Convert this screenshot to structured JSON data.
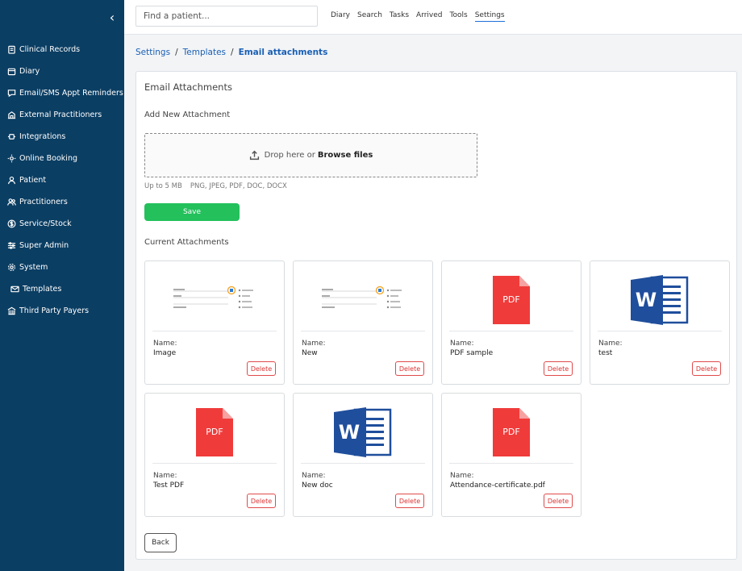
{
  "sidebar": {
    "items": [
      {
        "label": "Clinical Records",
        "icon": "clipboard-icon"
      },
      {
        "label": "Diary",
        "icon": "calendar-icon"
      },
      {
        "label": "Email/SMS Appt Reminders",
        "icon": "chat-icon"
      },
      {
        "label": "External Practitioners",
        "icon": "building-icon"
      },
      {
        "label": "Integrations",
        "icon": "plug-icon"
      },
      {
        "label": "Online Booking",
        "icon": "sun-icon"
      },
      {
        "label": "Patient",
        "icon": "user-icon"
      },
      {
        "label": "Practitioners",
        "icon": "users-icon"
      },
      {
        "label": "Service/Stock",
        "icon": "dollar-icon"
      },
      {
        "label": "Super Admin",
        "icon": "sliders-icon"
      },
      {
        "label": "System",
        "icon": "gear-icon"
      },
      {
        "label": "Templates",
        "icon": "envelope-icon"
      },
      {
        "label": "Third Party Payers",
        "icon": "bank-icon"
      }
    ]
  },
  "topbar": {
    "search_placeholder": "Find a patient...",
    "nav": [
      "Diary",
      "Search",
      "Tasks",
      "Arrived",
      "Tools",
      "Settings"
    ],
    "active": "Settings"
  },
  "breadcrumb": {
    "items": [
      "Settings",
      "Templates"
    ],
    "separator": "/",
    "current": "Email attachments"
  },
  "card": {
    "title": "Email Attachments",
    "add_label": "Add New Attachment",
    "dropzone_text": "Drop here or",
    "dropzone_link": "Browse files",
    "hint_size": "Up to 5 MB",
    "hint_types": "PNG, JPEG, PDF, DOC, DOCX",
    "save_label": "Save",
    "current_label": "Current Attachments",
    "name_label": "Name:",
    "delete_label": "Delete",
    "back_label": "Back"
  },
  "attachments": [
    {
      "name": "Image",
      "type": "image"
    },
    {
      "name": "New",
      "type": "image"
    },
    {
      "name": "PDF sample",
      "type": "pdf",
      "icon_text": "PDF"
    },
    {
      "name": "test",
      "type": "word",
      "icon_text": "W"
    },
    {
      "name": "Test PDF",
      "type": "pdf",
      "icon_text": "PDF"
    },
    {
      "name": "New doc",
      "type": "word",
      "icon_text": "W"
    },
    {
      "name": "Attendance-certificate.pdf",
      "type": "pdf",
      "icon_text": "PDF"
    }
  ],
  "colors": {
    "sidebar_bg": "#0b3e63",
    "link": "#1a5fb4",
    "save": "#23c05c",
    "delete": "#e04a4a",
    "pdf": "#f03b3b",
    "word": "#1f4e9c"
  }
}
